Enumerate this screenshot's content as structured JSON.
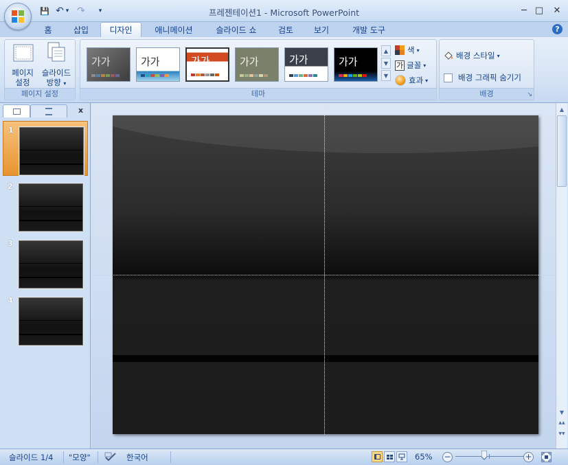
{
  "window": {
    "title": "프레젠테이션1 - Microsoft PowerPoint",
    "minimize": "─",
    "maximize": "□",
    "close": "✕"
  },
  "quick_access": {
    "save_glyph": "💾",
    "undo_glyph": "↶",
    "redo_glyph": "↷",
    "dropdown_glyph": "▾",
    "customize_glyph": "▾"
  },
  "tabs": [
    "홈",
    "삽입",
    "디자인",
    "애니메이션",
    "슬라이드 쇼",
    "검토",
    "보기",
    "개발 도구"
  ],
  "active_tab": "디자인",
  "help_glyph": "?",
  "ribbon": {
    "page_setup": {
      "page_setup_label_1": "페이지",
      "page_setup_label_2": "설정",
      "orientation_label_1": "슬라이드",
      "orientation_label_2": "방향",
      "orientation_arrow": "▾",
      "group_label": "페이지 설정"
    },
    "themes": {
      "group_label": "테마",
      "theme_text": "가가",
      "items": [
        {
          "bg": "#5a5a5a",
          "text": "#e0e0e0",
          "dots": [
            "#8b8b8b",
            "#5e7fa6",
            "#b0854a",
            "#7a9a55",
            "#9a5a5a",
            "#6a6a9a"
          ]
        },
        {
          "bg": "#ffffff",
          "text": "#333333",
          "dots": [
            "#1e4f8a",
            "#2aa1c1",
            "#c0504d",
            "#9bbb59",
            "#8064a2",
            "#f79646"
          ]
        },
        {
          "bg": "#ffffff",
          "text": "#ffffff",
          "dots": [
            "#c0392b",
            "#e67e22",
            "#b35a3a",
            "#999999",
            "#666666",
            "#d35400"
          ]
        },
        {
          "bg": "#7b806b",
          "text": "#f2f2e8",
          "dots": [
            "#c7c79c",
            "#a3b18a",
            "#e2c39b",
            "#8fa098",
            "#d8d8b0",
            "#b2967d"
          ]
        },
        {
          "bg": "#ffffff",
          "text": "#ffffff",
          "dots": [
            "#36404d",
            "#5b9bd5",
            "#6ab187",
            "#d66a3f",
            "#8c6fb0",
            "#2c8c8c"
          ]
        },
        {
          "bg": "#050505",
          "text": "#ffffff",
          "dots": [
            "#d72d5b",
            "#f0a30a",
            "#1ba1e2",
            "#60a917",
            "#a4c400",
            "#e51400"
          ]
        }
      ],
      "colors_label": "색",
      "fonts_label": "글꼴",
      "fonts_glyph": "가",
      "effects_label": "효과",
      "arrow": "▾",
      "gallery_up": "▲",
      "gallery_down": "▼",
      "gallery_more": "▼"
    },
    "background": {
      "styles_label": "배경 스타일",
      "hide_graphics_label": "배경 그래픽 숨기기",
      "hide_graphics_checked": false,
      "group_label": "배경",
      "launcher_glyph": "↘"
    }
  },
  "left_panel": {
    "close_glyph": "x",
    "slides": [
      {
        "number": "1",
        "selected": true
      },
      {
        "number": "2",
        "selected": false
      },
      {
        "number": "3",
        "selected": false
      },
      {
        "number": "4",
        "selected": false
      }
    ]
  },
  "scrollbar": {
    "up": "▲",
    "down": "▼",
    "prev_slide": "▲▲",
    "next_slide": "▼▼"
  },
  "status": {
    "slide_info": "슬라이드 1/4",
    "theme_name": "\"모양\"",
    "language": "한국어",
    "zoom": "65%",
    "zoom_out": "−",
    "zoom_in": "+",
    "zoom_level": 0.42
  }
}
